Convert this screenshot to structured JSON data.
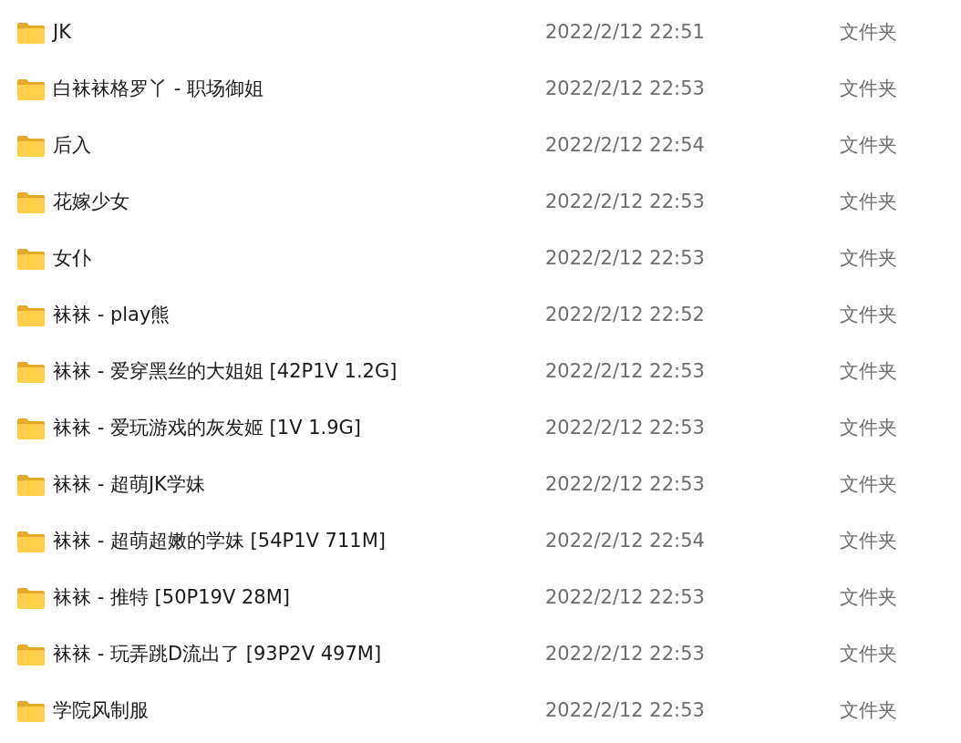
{
  "files": [
    {
      "name": "JK",
      "modified": "2022/2/12 22:51",
      "type": "文件夹"
    },
    {
      "name": "白袜袜格罗丫 - 职场御姐",
      "modified": "2022/2/12 22:53",
      "type": "文件夹"
    },
    {
      "name": "后入",
      "modified": "2022/2/12 22:54",
      "type": "文件夹"
    },
    {
      "name": "花嫁少女",
      "modified": "2022/2/12 22:53",
      "type": "文件夹"
    },
    {
      "name": "女仆",
      "modified": "2022/2/12 22:53",
      "type": "文件夹"
    },
    {
      "name": "袜袜 - play熊",
      "modified": "2022/2/12 22:52",
      "type": "文件夹"
    },
    {
      "name": "袜袜 - 爱穿黑丝的大姐姐 [42P1V 1.2G]",
      "modified": "2022/2/12 22:53",
      "type": "文件夹"
    },
    {
      "name": "袜袜 - 爱玩游戏的灰发姬 [1V 1.9G]",
      "modified": "2022/2/12 22:53",
      "type": "文件夹"
    },
    {
      "name": "袜袜 - 超萌JK学妹",
      "modified": "2022/2/12 22:53",
      "type": "文件夹"
    },
    {
      "name": "袜袜 - 超萌超嫩的学妹 [54P1V 711M]",
      "modified": "2022/2/12 22:54",
      "type": "文件夹"
    },
    {
      "name": "袜袜 - 推特 [50P19V 28M]",
      "modified": "2022/2/12 22:53",
      "type": "文件夹"
    },
    {
      "name": "袜袜 - 玩弄跳D流出了 [93P2V 497M]",
      "modified": "2022/2/12 22:53",
      "type": "文件夹"
    },
    {
      "name": "学院风制服",
      "modified": "2022/2/12 22:53",
      "type": "文件夹"
    }
  ]
}
